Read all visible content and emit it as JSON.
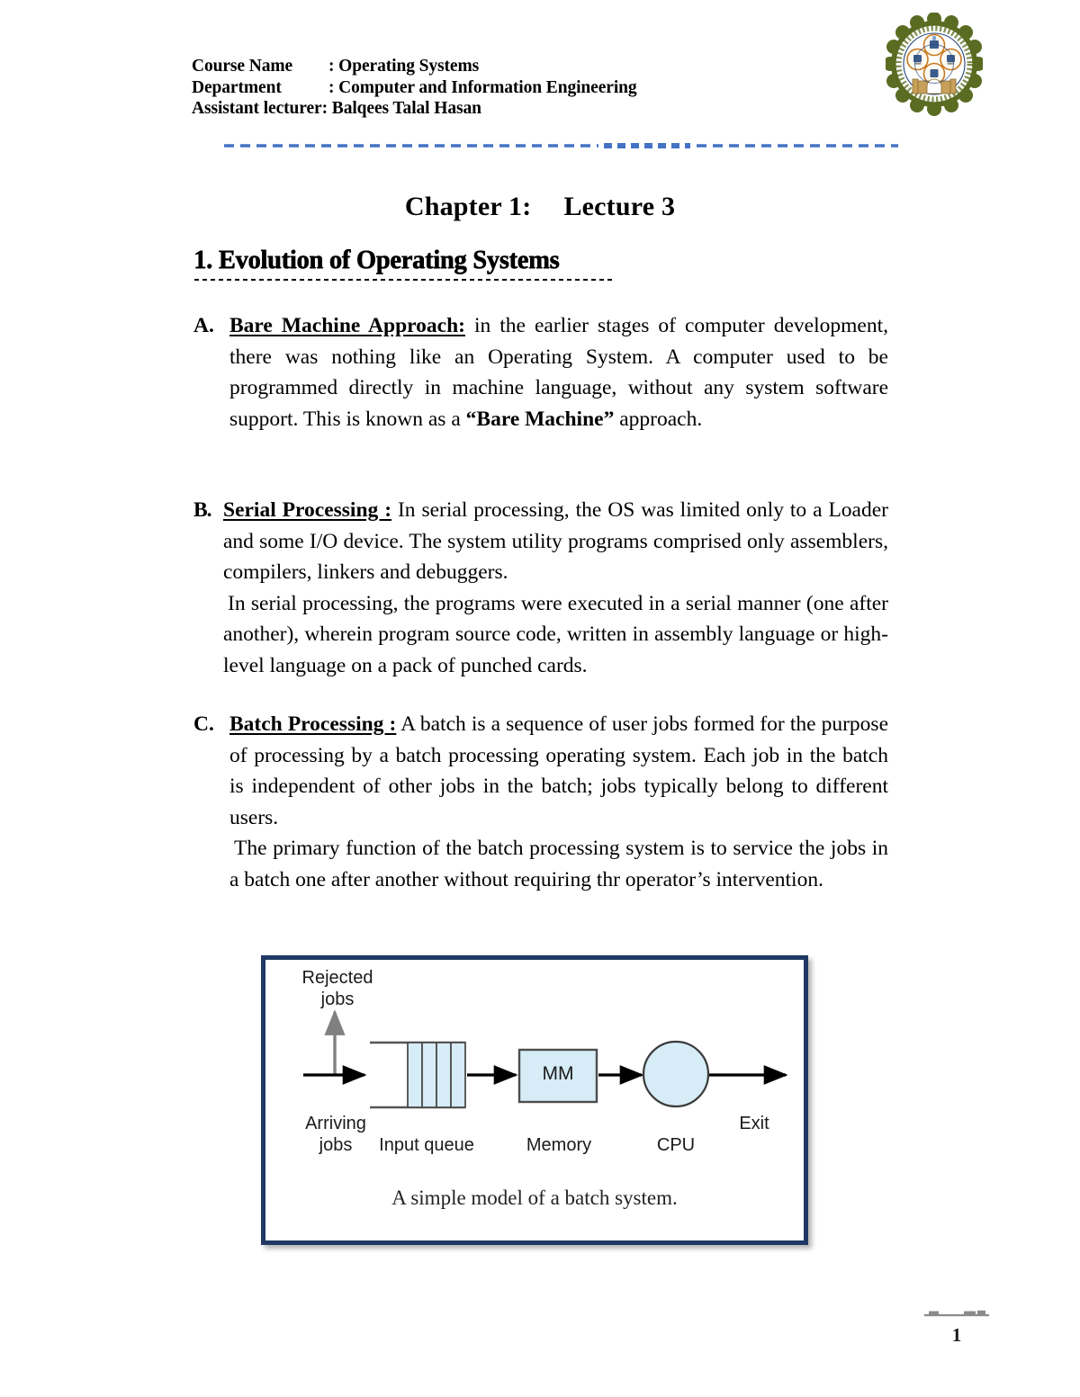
{
  "header": {
    "rows": [
      {
        "label": "Course Name",
        "sep": ": ",
        "value": "Operating Systems"
      },
      {
        "label": "Department",
        "sep": ": ",
        "value": "Computer and Information Engineering"
      },
      {
        "label": "Assistant lecturer",
        "sep": ": ",
        "value": "Balqees Talal Hasan"
      }
    ],
    "logo_alt": "University college emblem",
    "rule_color": "#4472C4"
  },
  "title": {
    "chapter": "Chapter 1:",
    "lecture": "Lecture 3",
    "heading": "1. Evolution of Operating Systems"
  },
  "sections": [
    {
      "marker": "A.",
      "lead": "Bare Machine Approach:",
      "body": " in the earlier stages of computer development, there was nothing like an Operating System. A computer used to be programmed directly in machine language, without any system software support. This is known as a ",
      "bold_tail": "“Bare Machine”",
      "tail": " approach."
    },
    {
      "marker": "B.",
      "lead": "Serial Processing :",
      "body": " In serial processing, the OS was limited only to a Loader and some I/O device. The system utility programs comprised only assemblers, compilers, linkers and debuggers.",
      "extra": " In serial processing, the programs were executed in a serial manner (one after another), wherein program source code, written in assembly language or high-level language on a pack of punched cards."
    },
    {
      "marker": "C.",
      "lead": "Batch Processing :",
      "body": " A batch is a sequence of user jobs formed for the purpose of processing by a batch processing operating system. Each job in the batch is independent of other jobs in the batch; jobs typically belong to different users.",
      "extra": "The primary function of the batch processing system is to service the jobs in a batch one after another without requiring thr operator’s intervention."
    }
  ],
  "figure": {
    "caption": "A simple model of a batch system.",
    "labels": {
      "rejected": "Rejected\njobs",
      "arriving": "Arriving\njobs",
      "input_queue": "Input queue",
      "memory": "Memory",
      "cpu": "CPU",
      "exit": "Exit",
      "memory_box": "MM"
    },
    "colors": {
      "border": "#1f3864",
      "shape_fill": "#d6ecf7",
      "shape_stroke": "#4d4d4d",
      "arrow": "#000000",
      "reject_arrow": "#808080"
    },
    "queue_cells": 4
  },
  "footer": {
    "page_number": "1"
  }
}
